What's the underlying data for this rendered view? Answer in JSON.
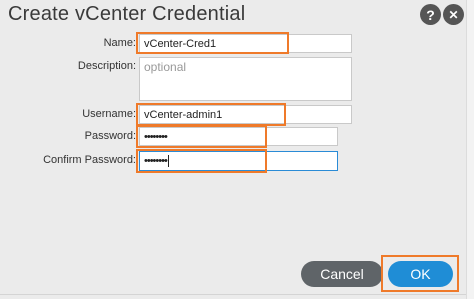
{
  "dialog": {
    "title": "Create vCenter Credential",
    "help_icon_glyph": "?",
    "close_icon_glyph": "✕"
  },
  "form": {
    "name_label": "Name:",
    "name_value": "vCenter-Cred1",
    "description_label": "Description:",
    "description_placeholder": "optional",
    "username_label": "Username:",
    "username_value": "vCenter-admin1",
    "password_label": "Password:",
    "password_value": "••••••••",
    "confirm_password_label": "Confirm Password:",
    "confirm_password_value": "••••••••"
  },
  "buttons": {
    "cancel_label": "Cancel",
    "ok_label": "OK"
  },
  "colors": {
    "highlight": "#ef7a2a",
    "ok_button": "#1f8dd6",
    "cancel_button": "#5f6468"
  }
}
